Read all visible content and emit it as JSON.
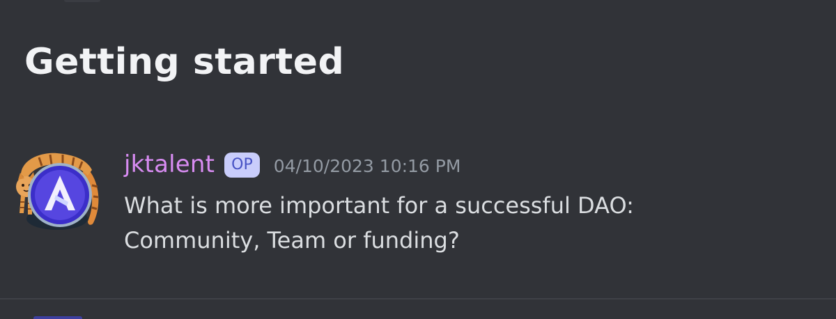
{
  "thread": {
    "title": "Getting started"
  },
  "message": {
    "author": "jktalent",
    "author_color": "#d88cf2",
    "badge": "OP",
    "timestamp": "04/10/2023 10:16 PM",
    "content_lines": [
      "What is more important for a successful DAO:",
      "Community, Team or funding?"
    ],
    "avatar_icon": "cat-with-letter-a-logo-icon"
  },
  "theme": {
    "background": "#313338",
    "title_color": "#f2f3f5",
    "text_color": "#dbdee1",
    "muted_color": "#949ba4",
    "badge_bg": "#c9cdfb",
    "badge_text": "#4752c4"
  }
}
